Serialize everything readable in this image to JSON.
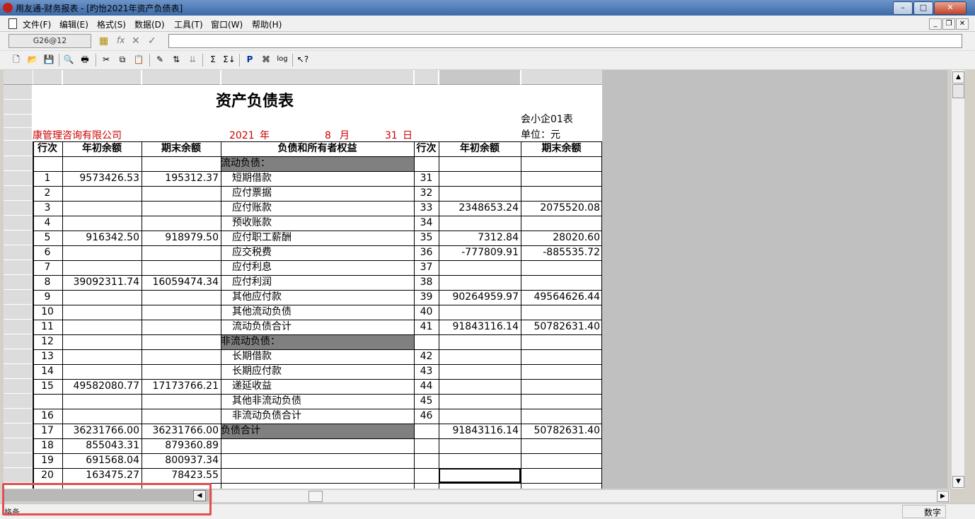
{
  "window": {
    "title": "用友通-财务报表 - [旳怡2021年资产负债表]"
  },
  "menu": {
    "items": [
      "文件(F)",
      "编辑(E)",
      "格式(S)",
      "数据(D)",
      "工具(T)",
      "窗口(W)",
      "帮助(H)"
    ]
  },
  "formula_bar": {
    "cell_ref": "G26@12",
    "value": ""
  },
  "report": {
    "title": "资产负债表",
    "form_code": "会小企01表",
    "unit": "单位：元",
    "company": "康管理咨询有限公司",
    "year": "2021",
    "year_unit": "年",
    "month": "8",
    "month_unit": "月",
    "day": "31",
    "day_unit": "日",
    "headers": {
      "line": "行次",
      "begin": "年初余额",
      "end": "期末余额",
      "item": "负债和所有者权益",
      "line2": "行次",
      "begin2": "年初余额",
      "end2": "期末余额"
    },
    "rows": [
      {
        "l": "",
        "b": "",
        "e": "",
        "item": "流动负债：",
        "l2": "",
        "b2": "",
        "e2": ""
      },
      {
        "l": "1",
        "b": "9573426.53",
        "e": "195312.37",
        "item": "短期借款",
        "l2": "31",
        "b2": "",
        "e2": ""
      },
      {
        "l": "2",
        "b": "",
        "e": "",
        "item": "应付票据",
        "l2": "32",
        "b2": "",
        "e2": ""
      },
      {
        "l": "3",
        "b": "",
        "e": "",
        "item": "应付账款",
        "l2": "33",
        "b2": "2348653.24",
        "e2": "2075520.08"
      },
      {
        "l": "4",
        "b": "",
        "e": "",
        "item": "预收账款",
        "l2": "34",
        "b2": "",
        "e2": ""
      },
      {
        "l": "5",
        "b": "916342.50",
        "e": "918979.50",
        "item": "应付职工薪酬",
        "l2": "35",
        "b2": "7312.84",
        "e2": "28020.60"
      },
      {
        "l": "6",
        "b": "",
        "e": "",
        "item": "应交税费",
        "l2": "36",
        "b2": "-777809.91",
        "e2": "-885535.72"
      },
      {
        "l": "7",
        "b": "",
        "e": "",
        "item": "应付利息",
        "l2": "37",
        "b2": "",
        "e2": ""
      },
      {
        "l": "8",
        "b": "39092311.74",
        "e": "16059474.34",
        "item": "应付利润",
        "l2": "38",
        "b2": "",
        "e2": ""
      },
      {
        "l": "9",
        "b": "",
        "e": "",
        "item": "其他应付款",
        "l2": "39",
        "b2": "90264959.97",
        "e2": "49564626.44"
      },
      {
        "l": "10",
        "b": "",
        "e": "",
        "item": "其他流动负债",
        "l2": "40",
        "b2": "",
        "e2": ""
      },
      {
        "l": "11",
        "b": "",
        "e": "",
        "item": "流动负债合计",
        "l2": "41",
        "b2": "91843116.14",
        "e2": "50782631.40"
      },
      {
        "l": "12",
        "b": "",
        "e": "",
        "item": "非流动负债：",
        "l2": "",
        "b2": "",
        "e2": ""
      },
      {
        "l": "13",
        "b": "",
        "e": "",
        "item": "长期借款",
        "l2": "42",
        "b2": "",
        "e2": ""
      },
      {
        "l": "14",
        "b": "",
        "e": "",
        "item": "长期应付款",
        "l2": "43",
        "b2": "",
        "e2": ""
      },
      {
        "l": "15",
        "b": "49582080.77",
        "e": "17173766.21",
        "item": "递延收益",
        "l2": "44",
        "b2": "",
        "e2": ""
      },
      {
        "l": "",
        "b": "",
        "e": "",
        "item": "其他非流动负债",
        "l2": "45",
        "b2": "",
        "e2": ""
      },
      {
        "l": "16",
        "b": "",
        "e": "",
        "item": "非流动负债合计",
        "l2": "46",
        "b2": "",
        "e2": ""
      },
      {
        "l": "17",
        "b": "36231766.00",
        "e": "36231766.00",
        "item": "负债合计",
        "l2": "",
        "b2": "91843116.14",
        "e2": "50782631.40"
      },
      {
        "l": "18",
        "b": "855043.31",
        "e": "879360.89",
        "item": "",
        "l2": "",
        "b2": "",
        "e2": ""
      },
      {
        "l": "19",
        "b": "691568.04",
        "e": "800937.34",
        "item": "",
        "l2": "",
        "b2": "",
        "e2": ""
      },
      {
        "l": "20",
        "b": "163475.27",
        "e": "78423.55",
        "item": "",
        "l2": "",
        "b2": "",
        "e2": ""
      }
    ]
  },
  "status": {
    "left": "格备",
    "mode": "数字"
  },
  "colors": {
    "title_bar": "#3a6aa8",
    "red_text": "#cc0000",
    "section_fill": "#808080",
    "highlight_border": "#e05050"
  }
}
